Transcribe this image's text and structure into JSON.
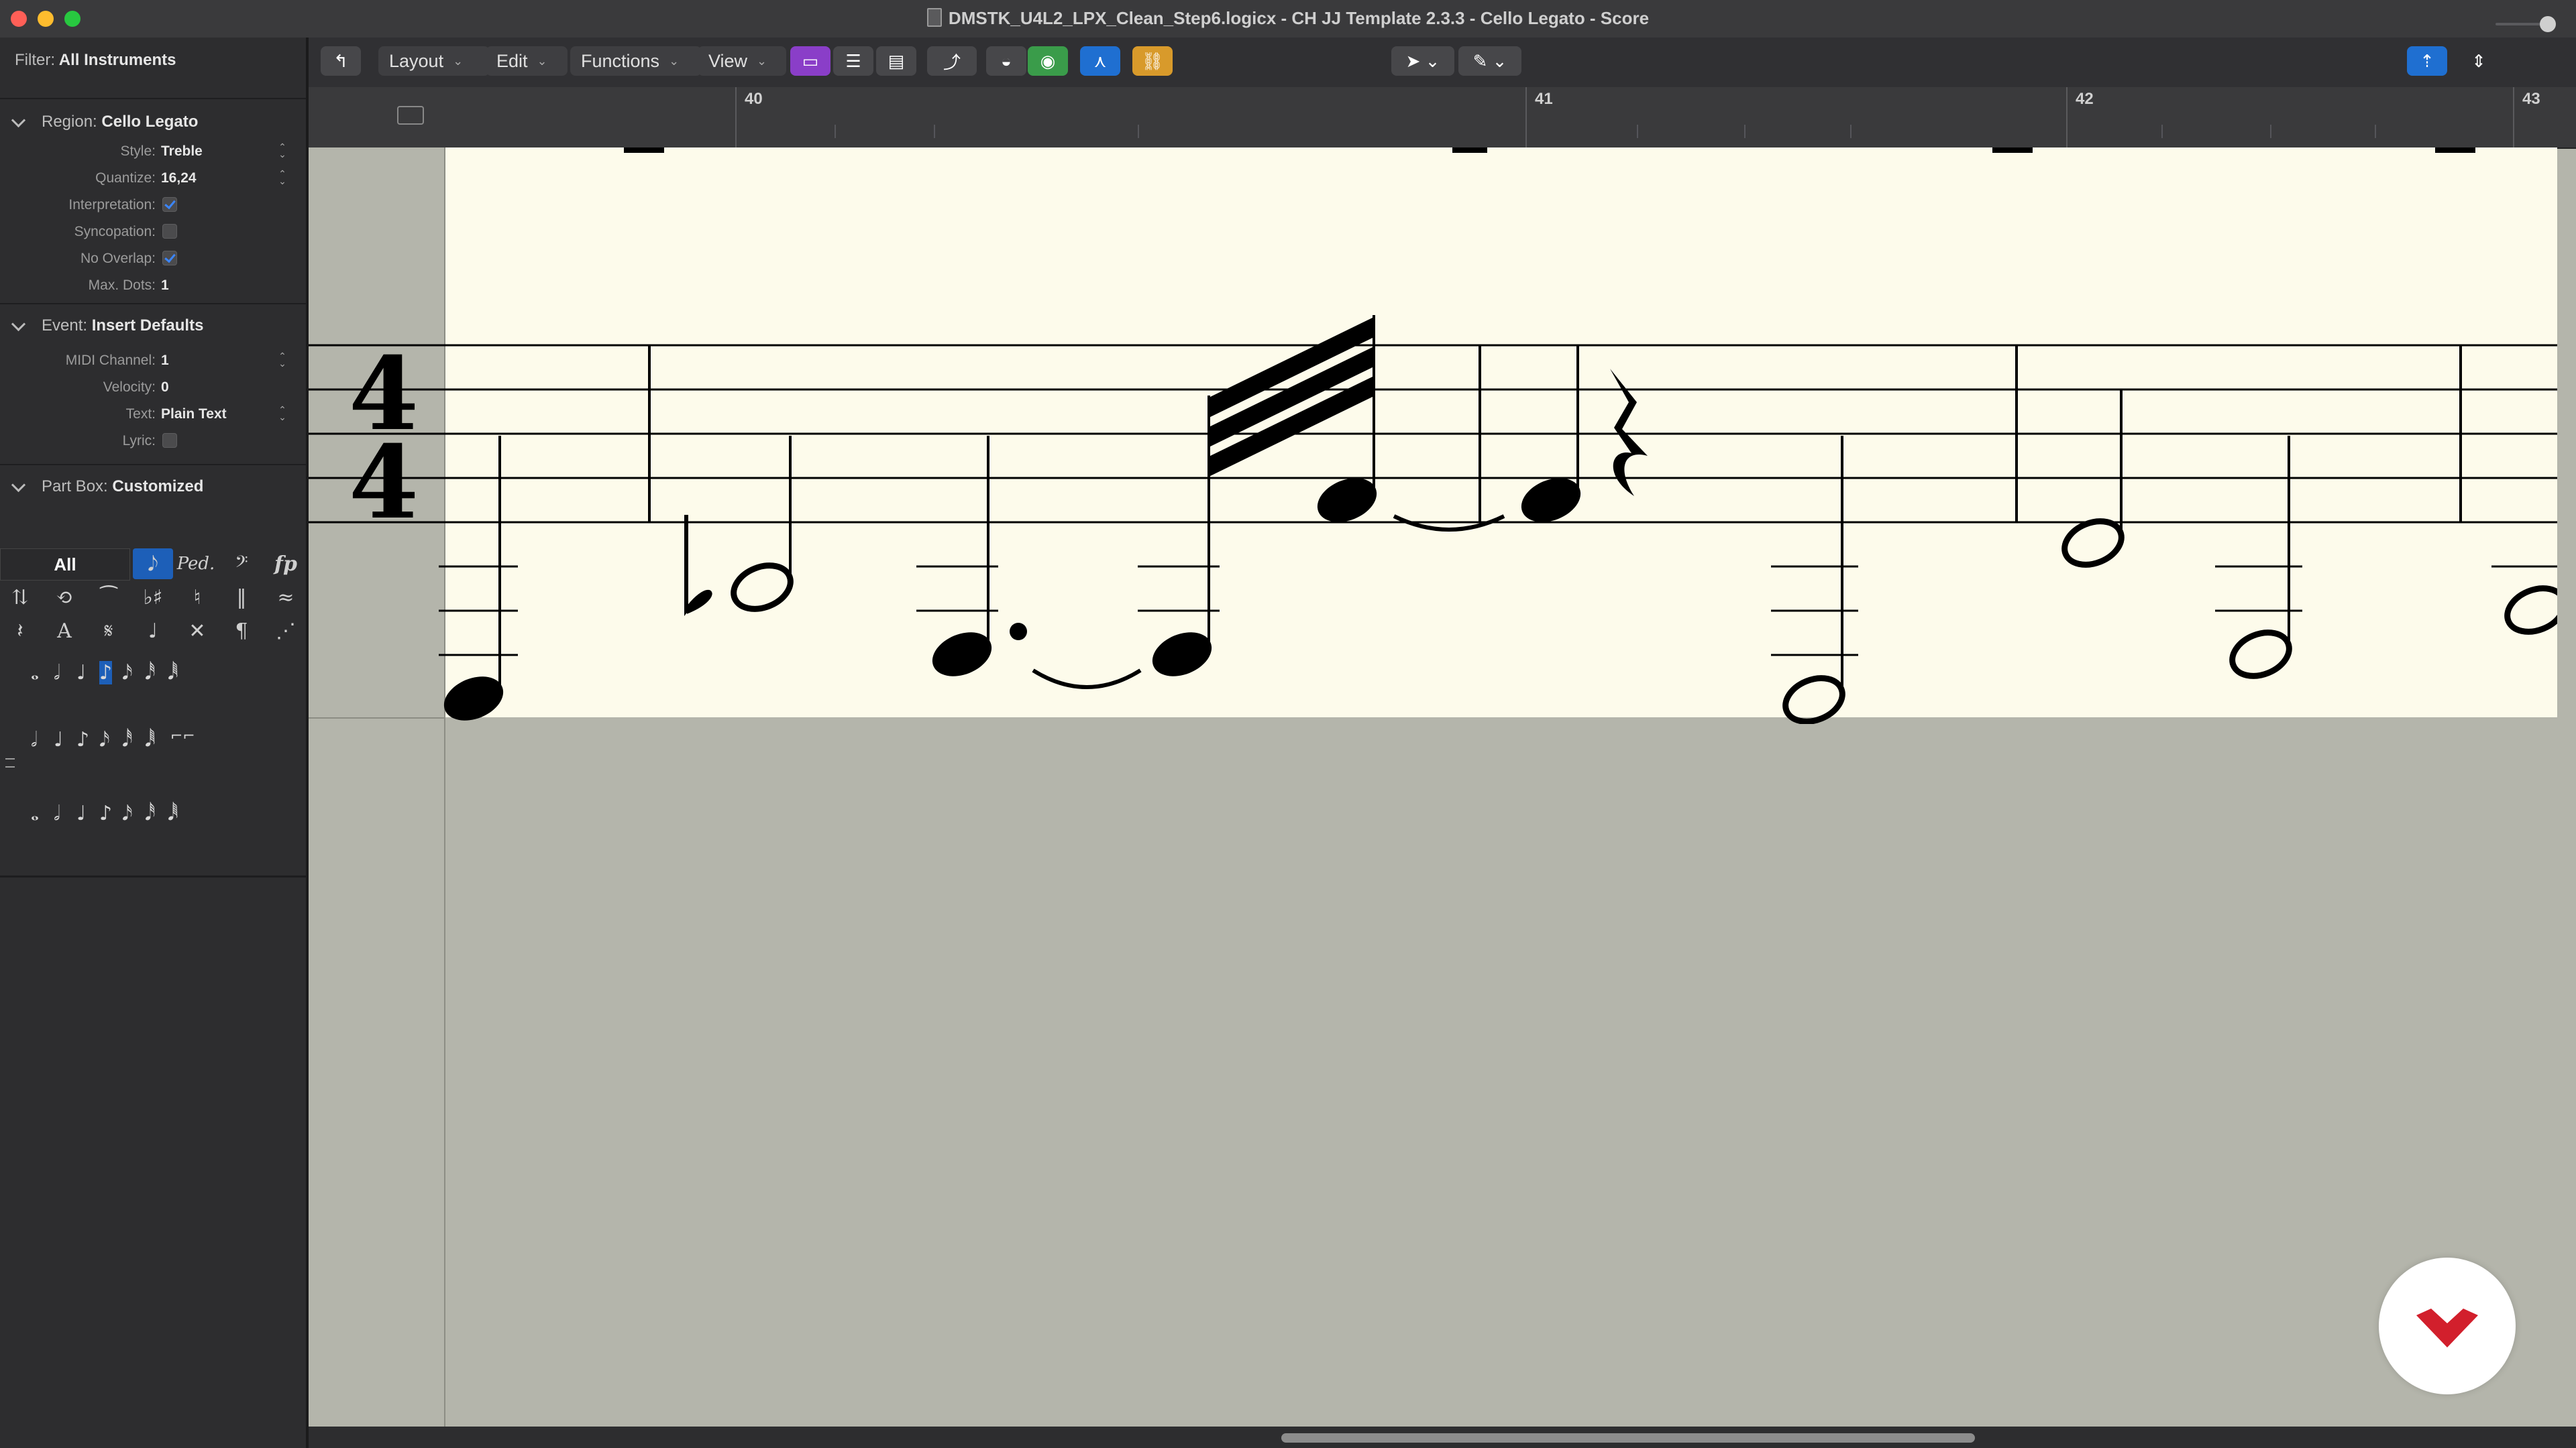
{
  "window": {
    "title": "DMSTK_U4L2_LPX_Clean_Step6.logicx - CH JJ Template 2.3.3 - Cello Legato - Score"
  },
  "inspector": {
    "filter": {
      "label": "Filter:",
      "value": "All Instruments"
    },
    "region": {
      "label": "Region:",
      "value": "Cello Legato",
      "params": {
        "style": {
          "label": "Style:",
          "value": "Treble"
        },
        "quantize": {
          "label": "Quantize:",
          "value": "16,24"
        },
        "interpretation": {
          "label": "Interpretation:",
          "checked": true
        },
        "syncopation": {
          "label": "Syncopation:",
          "checked": false
        },
        "no_overlap": {
          "label": "No Overlap:",
          "checked": true
        },
        "max_dots": {
          "label": "Max. Dots:",
          "value": "1"
        }
      }
    },
    "event": {
      "label": "Event:",
      "value": "Insert Defaults",
      "params": {
        "midi_channel": {
          "label": "MIDI Channel:",
          "value": "1"
        },
        "velocity": {
          "label": "Velocity:",
          "value": "0"
        },
        "text": {
          "label": "Text:",
          "value": "Plain Text"
        },
        "lyric": {
          "label": "Lyric:",
          "checked": false
        }
      }
    },
    "part_box": {
      "label": "Part Box:",
      "value": "Customized",
      "all_label": "All"
    }
  },
  "toolbar": {
    "layout": "Layout",
    "edit": "Edit",
    "functions": "Functions",
    "view": "View"
  },
  "ruler": {
    "bars": [
      "40",
      "41",
      "42",
      "43"
    ]
  },
  "score": {
    "time_signature": {
      "top": "4",
      "bottom": "4"
    }
  },
  "colors": {
    "score_paper": "#fdfbeb",
    "accent_blue": "#1f6fd1",
    "accent_purple": "#8a3ec8",
    "accent_green": "#3a9c4a",
    "accent_orange": "#d89a2b",
    "logo_red": "#d21f2c"
  }
}
